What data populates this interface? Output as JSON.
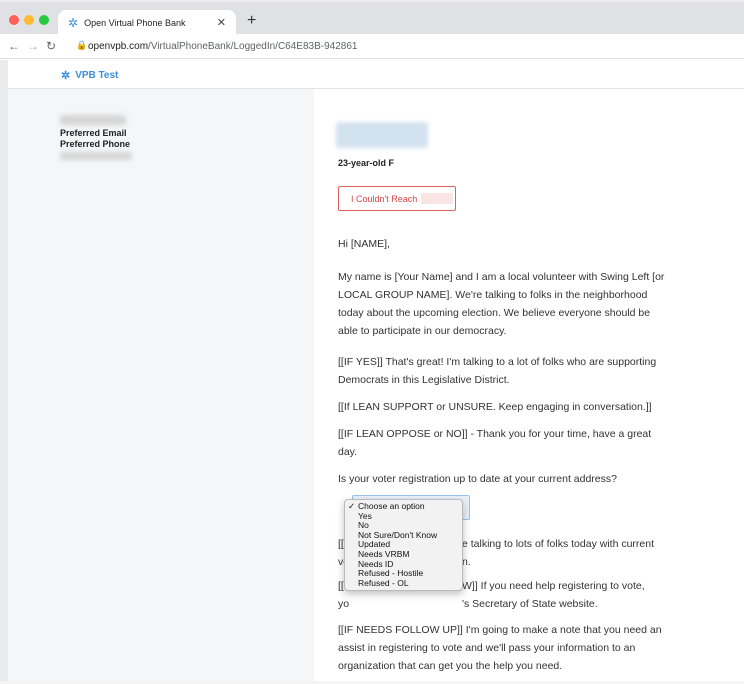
{
  "browser": {
    "tab_title": "Open Virtual Phone Bank",
    "url_host": "openvpb.com",
    "url_path": "/VirtualPhoneBank/LoggedIn/C64E83B-942861",
    "colors": {
      "close": "#ff5f57",
      "min": "#febc2e",
      "max": "#28c840"
    }
  },
  "app": {
    "brand": "VPB Test"
  },
  "sidebar": {
    "email_label": "Preferred Email",
    "phone_label": "Preferred Phone"
  },
  "contact": {
    "age_gender": "23-year-old F",
    "reach_button": "I Couldn't Reach"
  },
  "script": {
    "greeting": "Hi [NAME],",
    "p1_l1": "My name is [Your Name] and I am a local volunteer with Swing Left [or",
    "p1_l2": "LOCAL GROUP NAME]. We're talking to folks in the neighborhood",
    "p1_l3": "today about the upcoming election. We believe everyone should be",
    "p1_l4": "able to participate in our democracy.",
    "p2_l1": "[[IF YES]] That's great! I'm talking to a lot of folks who are supporting",
    "p2_l2": "Democrats in this Legislative District.",
    "p3": "[[If LEAN SUPPORT or UNSURE. Keep engaging in conversation.]]",
    "p4_l1": "[[IF LEAN OPPOSE or NO]] - Thank you for your time, have a great",
    "p4_l2": "day.",
    "question": "Is your voter registration up to date at your current address?",
    "p5_a": "[[I",
    "p5_b": "e talking to lots of folks today with current",
    "p5_c": "vo",
    "p5_d": "n.",
    "p6_a": "[[I",
    "p6_b": "W]] If you need help registering to vote,",
    "p6_c": "yo",
    "p6_d": "'s Secretary of State website.",
    "p7_l1": "[[IF NEEDS FOLLOW UP]] I'm going to make a note that you need an",
    "p7_l2": "assist in registering to vote and we'll pass your information to an",
    "p7_l3": "organization that can get you the help you need."
  },
  "dropdown": {
    "options": [
      "Choose an option",
      "Yes",
      "No",
      "Not Sure/Don't Know",
      "Updated",
      "Needs VRBM",
      "Needs ID",
      "Refused - Hostile",
      "Refused - OL"
    ],
    "checkmark": "✓"
  }
}
